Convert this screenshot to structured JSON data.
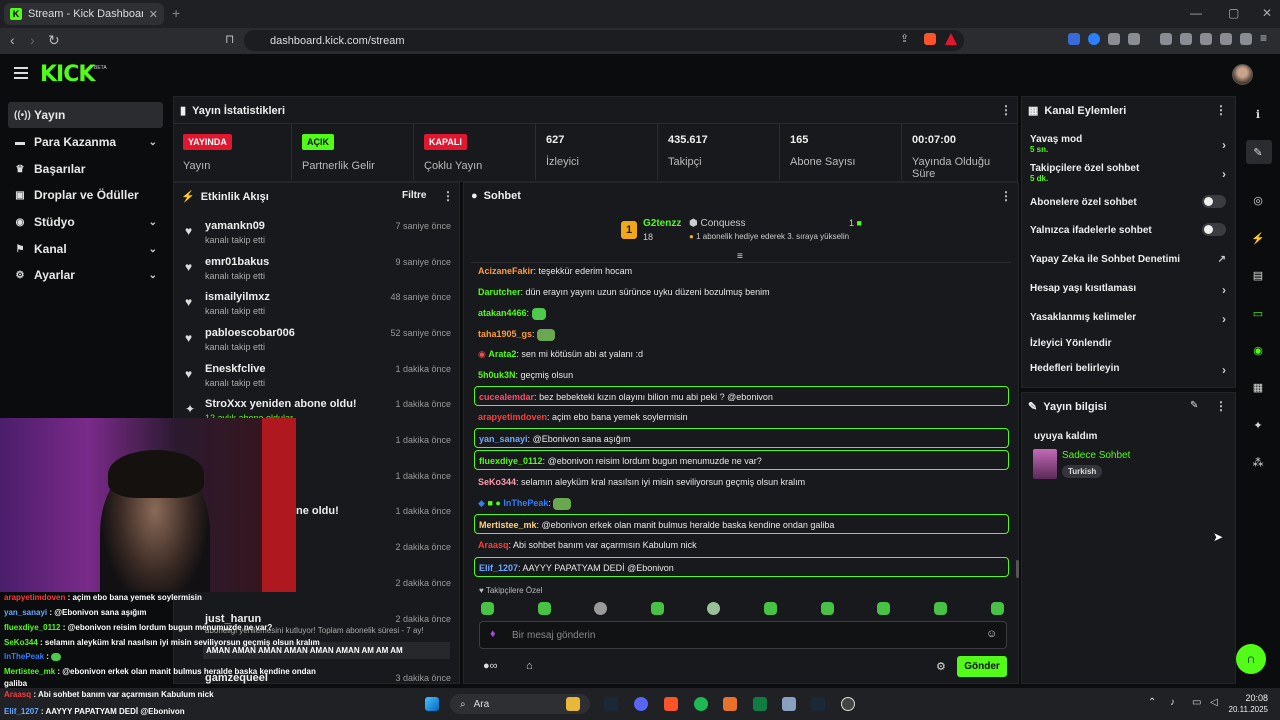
{
  "browser": {
    "tab_title": "Stream - Kick Dashboard",
    "url": "dashboard.kick.com/stream",
    "new_tab": "+"
  },
  "header": {
    "logo": "KICK",
    "beta": "BETA"
  },
  "sidebar": {
    "items": [
      {
        "label": "Yayın",
        "icon": "broadcast-icon",
        "chevron": false,
        "active": true
      },
      {
        "label": "Para Kazanma",
        "icon": "money-icon",
        "chevron": true
      },
      {
        "label": "Başarılar",
        "icon": "trophy-icon",
        "chevron": false
      },
      {
        "label": "Droplar ve Ödüller",
        "icon": "gift-icon",
        "chevron": false
      },
      {
        "label": "Stüdyo",
        "icon": "camera-icon",
        "chevron": true
      },
      {
        "label": "Kanal",
        "icon": "channel-icon",
        "chevron": true
      },
      {
        "label": "Ayarlar",
        "icon": "gear-icon",
        "chevron": true
      }
    ]
  },
  "stats": {
    "title": "Yayın İstatistikleri",
    "cells": [
      {
        "badge": "YAYINDA",
        "badge_color": "#e0172f",
        "label": "Yayın"
      },
      {
        "badge": "AÇIK",
        "badge_color": "#53fc18",
        "label": "Partnerlik Gelir Programı"
      },
      {
        "badge": "KAPALI",
        "badge_color": "#e0172f",
        "label": "Çoklu Yayın"
      },
      {
        "value": "627",
        "label": "İzleyici"
      },
      {
        "value": "435.617",
        "label": "Takipçi"
      },
      {
        "value": "165",
        "label": "Abone Sayısı"
      },
      {
        "value": "00:07:00",
        "label": "Yayında Olduğu Süre"
      }
    ]
  },
  "feed": {
    "title": "Etkinlik Akışı",
    "filter": "Filtre",
    "items": [
      {
        "name": "yamankn09",
        "sub": "kanalı takip etti",
        "time": "7 saniye önce",
        "icon": "heart-icon"
      },
      {
        "name": "emr01bakus",
        "sub": "kanalı takip etti",
        "time": "9 saniye önce",
        "icon": "heart-icon"
      },
      {
        "name": "ismailyilmxz",
        "sub": "kanalı takip etti",
        "time": "48 saniye önce",
        "icon": "heart-icon"
      },
      {
        "name": "pabloescobar006",
        "sub": "kanalı takip etti",
        "time": "52 saniye önce",
        "icon": "heart-icon"
      },
      {
        "name": "Eneskfclive",
        "sub": "kanalı takip etti",
        "time": "1 dakika önce",
        "icon": "heart-icon"
      },
      {
        "name": "StroXxx yeniden abone oldu!",
        "sub": "12 aylık abone oldular",
        "time": "1 dakika önce",
        "icon": "star-icon"
      },
      {
        "name": "",
        "sub": "",
        "time": "1 dakika önce",
        "icon": ""
      },
      {
        "name": "",
        "sub": "",
        "time": "1 dakika önce",
        "icon": ""
      },
      {
        "name": "ne oldu!",
        "sub": "",
        "time": "1 dakika önce",
        "icon": ""
      },
      {
        "name": "",
        "sub": "",
        "time": "2 dakika önce",
        "icon": ""
      },
      {
        "name": "",
        "sub": "",
        "time": "2 dakika önce",
        "icon": ""
      },
      {
        "name": "just_harun",
        "sub": "aboneliği yenilemesini kutluyor! Toplam abonelik süresi - 7 ay!",
        "time": "2 dakika önce",
        "icon": ""
      },
      {
        "name": "gamzequeel",
        "sub": "",
        "time": "3 dakika önce",
        "icon": ""
      }
    ],
    "spam": "AMAN AMAN AMAN AMAN AMAN AMAN AM AM AM"
  },
  "chat": {
    "title": "Sohbet",
    "pinned": {
      "user": "G2tenzz",
      "rank": "1",
      "count": "18",
      "gifter": "Conquess",
      "gift_text": "1 abonelik hediye ederek 3. sıraya yükselin",
      "gift_count": "1"
    },
    "messages": [
      {
        "user": "AcizaneFakir",
        "color": "#ff9c3a",
        "text": "teşekkür ederim hocam",
        "box": false
      },
      {
        "user": "Darutcher",
        "color": "#53fc18",
        "text": "dün erayın yayını uzun sürünce uyku düzeni bozulmuş benim",
        "box": false
      },
      {
        "user": "atakan4466",
        "color": "#53fc18",
        "text": "",
        "emote": true,
        "box": false
      },
      {
        "user": "taha1905_gs",
        "color": "#ff9c3a",
        "text": "",
        "emote": true,
        "box": false
      },
      {
        "user": "Arata2",
        "color": "#53fc18",
        "text": "sen mi kötüsün abi at yalanı :d",
        "box": false
      },
      {
        "user": "5h0uk3N",
        "color": "#53fc18",
        "text": "geçmiş olsun",
        "box": false
      },
      {
        "user": "cuceaIemdar",
        "color": "#ff4a6a",
        "text": "bez bebekteki kızın olayını bilion mu abi peki ? @ebonivon",
        "box": true
      },
      {
        "user": "arapyetimdoven",
        "color": "#ff3a3a",
        "text": "açim ebo bana yemek soylermisin",
        "box": false
      },
      {
        "user": "yan_sanayi",
        "color": "#6aa8ff",
        "text": "@Ebonivon sana aşığım",
        "box": true
      },
      {
        "user": "fluexdiye_0112",
        "color": "#53fc18",
        "text": "@ebonivon reisim lordum bugun menumuzde ne var?",
        "box": true
      },
      {
        "user": "SeKo344",
        "color": "#ff9ab0",
        "text": "selamın aleyküm kral nasılsın iyi misin seviliyorsun geçmiş olsun kralım",
        "box": false
      },
      {
        "user": "InThePeak",
        "color": "#2f7cff",
        "text": "",
        "emote": true,
        "box": false
      },
      {
        "user": "Mertistee_mk",
        "color": "#ffd27a",
        "text": "@ebonivon erkek olan manit bulmus heralde baska kendine ondan galiba",
        "box": true
      },
      {
        "user": "Araasq",
        "color": "#ff3a3a",
        "text": "Abi sohbet banım var açarmısın Kabulum nick",
        "box": false
      },
      {
        "user": "Elif_1207",
        "color": "#6aa8ff",
        "text": "AAYYY PAPATYAM DEDİ @Ebonivon",
        "box": true
      }
    ],
    "followers_label": "Takipçilere Özel",
    "input_placeholder": "Bir mesaj gönderin",
    "send": "Gönder"
  },
  "channel_actions": {
    "title": "Kanal Eylemleri",
    "items": [
      {
        "label": "Yavaş mod",
        "sub": "5 sn.",
        "type": "arrow"
      },
      {
        "label": "Takipçilere özel sohbet",
        "sub": "5 dk.",
        "type": "arrow"
      },
      {
        "label": "Abonelere özel sohbet",
        "sub": "",
        "type": "toggle"
      },
      {
        "label": "Yalnızca ifadelerle sohbet",
        "sub": "",
        "type": "toggle"
      },
      {
        "label": "Yapay Zeka ile Sohbet Denetimi",
        "sub": "",
        "type": "external"
      },
      {
        "label": "Hesap yaşı kısıtlaması",
        "sub": "",
        "type": "arrow"
      },
      {
        "label": "Yasaklanmış kelimeler",
        "sub": "",
        "type": "arrow"
      },
      {
        "label": "İzleyici Yönlendir",
        "sub": "",
        "type": "none"
      },
      {
        "label": "Hedefleri belirleyin",
        "sub": "",
        "type": "arrow"
      }
    ]
  },
  "stream_info": {
    "title": "Yayın bilgisi",
    "stream_title": "uyuya kaldım",
    "category": "Sadece Sohbet",
    "tag": "Turkish"
  },
  "overlay_chat": [
    {
      "user": "arapyetimdoven",
      "color": "#ff3a3a",
      "text": "açim ebo bana yemek soylermisin"
    },
    {
      "user": "yan_sanayi",
      "color": "#6aa8ff",
      "text": "@Ebonivon sana aşığım"
    },
    {
      "user": "fluexdiye_0112",
      "color": "#53fc18",
      "text": "@ebonivon reisim lordum bugun menumuzde ne var?"
    },
    {
      "user": "SeKo344",
      "color": "#53fc18",
      "text": "selamın aleyküm kral nasılsın iyi misin seviliyorsun geçmiş olsun kralım"
    },
    {
      "user": "InThePeak",
      "color": "#2f7cff",
      "text": ""
    },
    {
      "user": "Mertistee_mk",
      "color": "#53fc18",
      "text": "@ebonivon erkek olan manit bulmus heralde baska kendine ondan"
    },
    {
      "user": "",
      "color": "#ffffff",
      "text": "galiba"
    },
    {
      "user": "Araasq",
      "color": "#ff3a3a",
      "text": "Abi sohbet banım var açarmısın Kabulum nick"
    },
    {
      "user": "Elif_1207",
      "color": "#6aa8ff",
      "text": "AAYYY PAPATYAM DEDİ @Ebonivon"
    }
  ],
  "taskbar": {
    "search": "Ara",
    "time": "20:08",
    "date": "20.11.2025"
  }
}
